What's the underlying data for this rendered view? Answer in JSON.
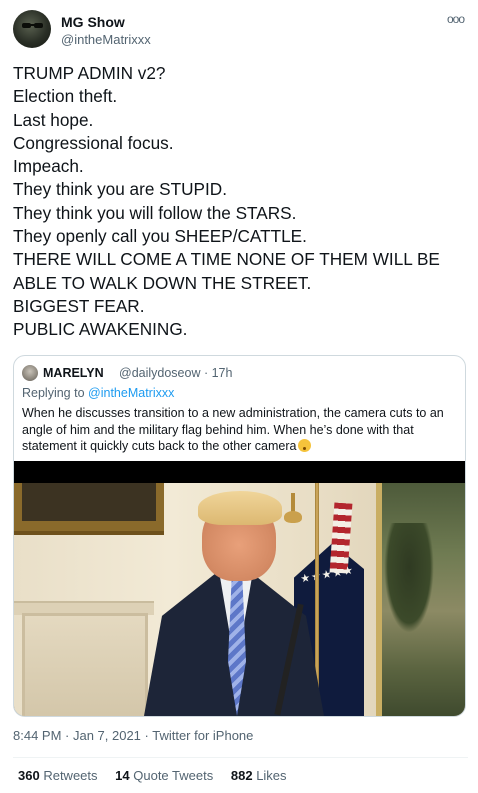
{
  "author": {
    "display_name": "MG Show",
    "handle": "@intheMatrixxx"
  },
  "more_icon": "ooo",
  "tweet_lines": [
    "TRUMP ADMIN v2?",
    "Election theft.",
    "Last hope.",
    "Congressional focus.",
    "Impeach.",
    "They think you are STUPID.",
    "They think you will follow the STARS.",
    "They openly call you SHEEP/CATTLE.",
    "THERE WILL COME A TIME NONE OF THEM WILL BE",
    "ABLE TO WALK DOWN THE STREET.",
    "BIGGEST FEAR.",
    "PUBLIC AWAKENING."
  ],
  "quoted": {
    "name": "MARELYN",
    "handle_time": "@dailydoseow · 17h",
    "replying_prefix": "Replying to",
    "replying_handle": "@intheMatrixxx",
    "text_lines": [
      "When he discusses transition to a new administration, the camera cuts to an",
      "angle of him and the military flag behind him. When he’s done with that",
      "statement it quickly cuts back to the other camera"
    ],
    "emoji": "thinking-face-emoji"
  },
  "meta": {
    "timestamp": "8:44 PM · Jan 7, 2021 · Twitter for iPhone"
  },
  "stats": {
    "retweets_count": "360",
    "retweets_label": "Retweets",
    "quotes_count": "14",
    "quotes_label": "Quote Tweets",
    "likes_count": "882",
    "likes_label": "Likes"
  },
  "colors": {
    "text": "#0f1419",
    "secondary": "#536471",
    "link": "#1d9bf0",
    "border": "#cfd9de"
  }
}
